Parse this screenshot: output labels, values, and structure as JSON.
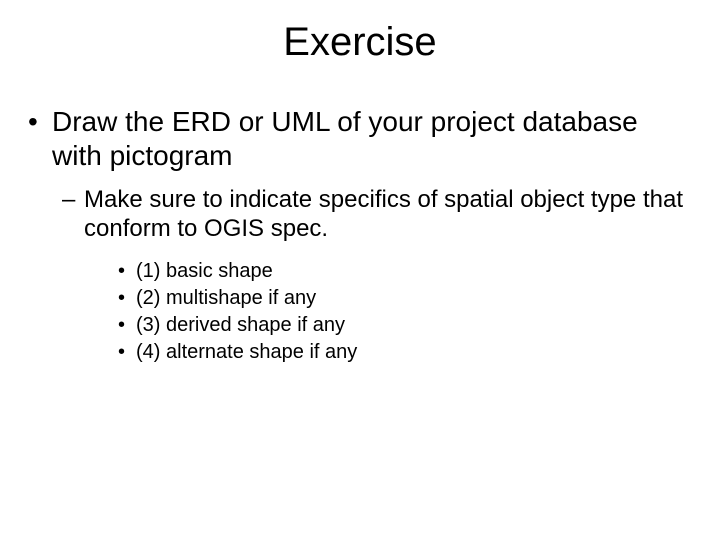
{
  "title": "Exercise",
  "level1": {
    "bullet": "•",
    "text": "Draw the ERD or UML of your project database with pictogram"
  },
  "level2": {
    "dash": "–",
    "text": "Make sure to indicate specifics of spatial object type that conform to OGIS spec."
  },
  "level3": {
    "bullet": "•",
    "items": [
      "(1) basic shape",
      "(2) multishape if any",
      "(3) derived shape if any",
      "(4) alternate shape if any"
    ]
  }
}
